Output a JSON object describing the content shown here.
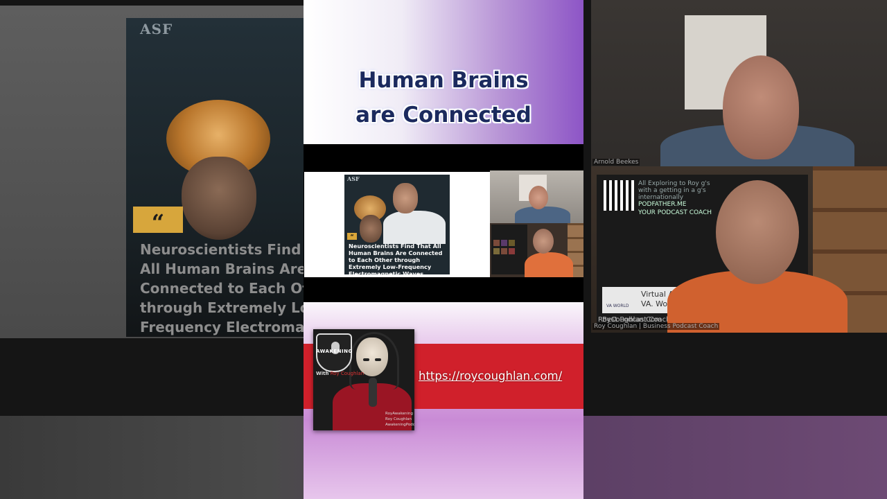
{
  "background": {
    "left_slide": {
      "brand": "ASF",
      "quote_mark": "“",
      "headline": "Neuroscientists Find That All Human Brains Are Connected to Each Other through Extremely Low-Frequency Electromagnetic Waves",
      "headline_visible": "Neuroscientists Fir\nHuman Brains Are (\nEach Other throug\nLow-Frequency Ele\nWaves"
    },
    "right_upper": {
      "name_label": "Arnold Beekes"
    },
    "right_lower": {
      "panel_text_1": "All Exploring to Roy g's with a getting in a g's internationally",
      "panel_text_2": "PODFATHER.ME",
      "panel_text_3": "YOUR PODCAST COACH",
      "va_text": "Virtual Assistant to VA. World",
      "va_brand": "VA WORLD",
      "coach_1": "Best Podcast Coach",
      "coach_2": "RoyCoughlan.Com",
      "name_label": "Roy Coughlan | Business Podcast Coach"
    }
  },
  "title": {
    "line1": "Human Brains",
    "line2": "are Connected"
  },
  "video": {
    "mini_brand": "ASF",
    "mini_quote": "“",
    "mini_headline": "Neuroscientists Find That All Human Brains Are Connected to Each Other through Extremely Low-Frequency Electromagnetic Waves"
  },
  "podcast": {
    "show_name": "AWAKENING",
    "with_prefix": "With",
    "host": "Roy Coughlan",
    "handle_1": "RoyAwakening",
    "handle_2": "Roy Coughlan",
    "handle_3": "AwakeningPodcast.Org"
  },
  "link": {
    "url": "https://roycoughlan.com/"
  },
  "colors": {
    "red_band": "#d0202b",
    "title_text": "#1b2a5e",
    "purple_accent": "#8d55c6"
  }
}
